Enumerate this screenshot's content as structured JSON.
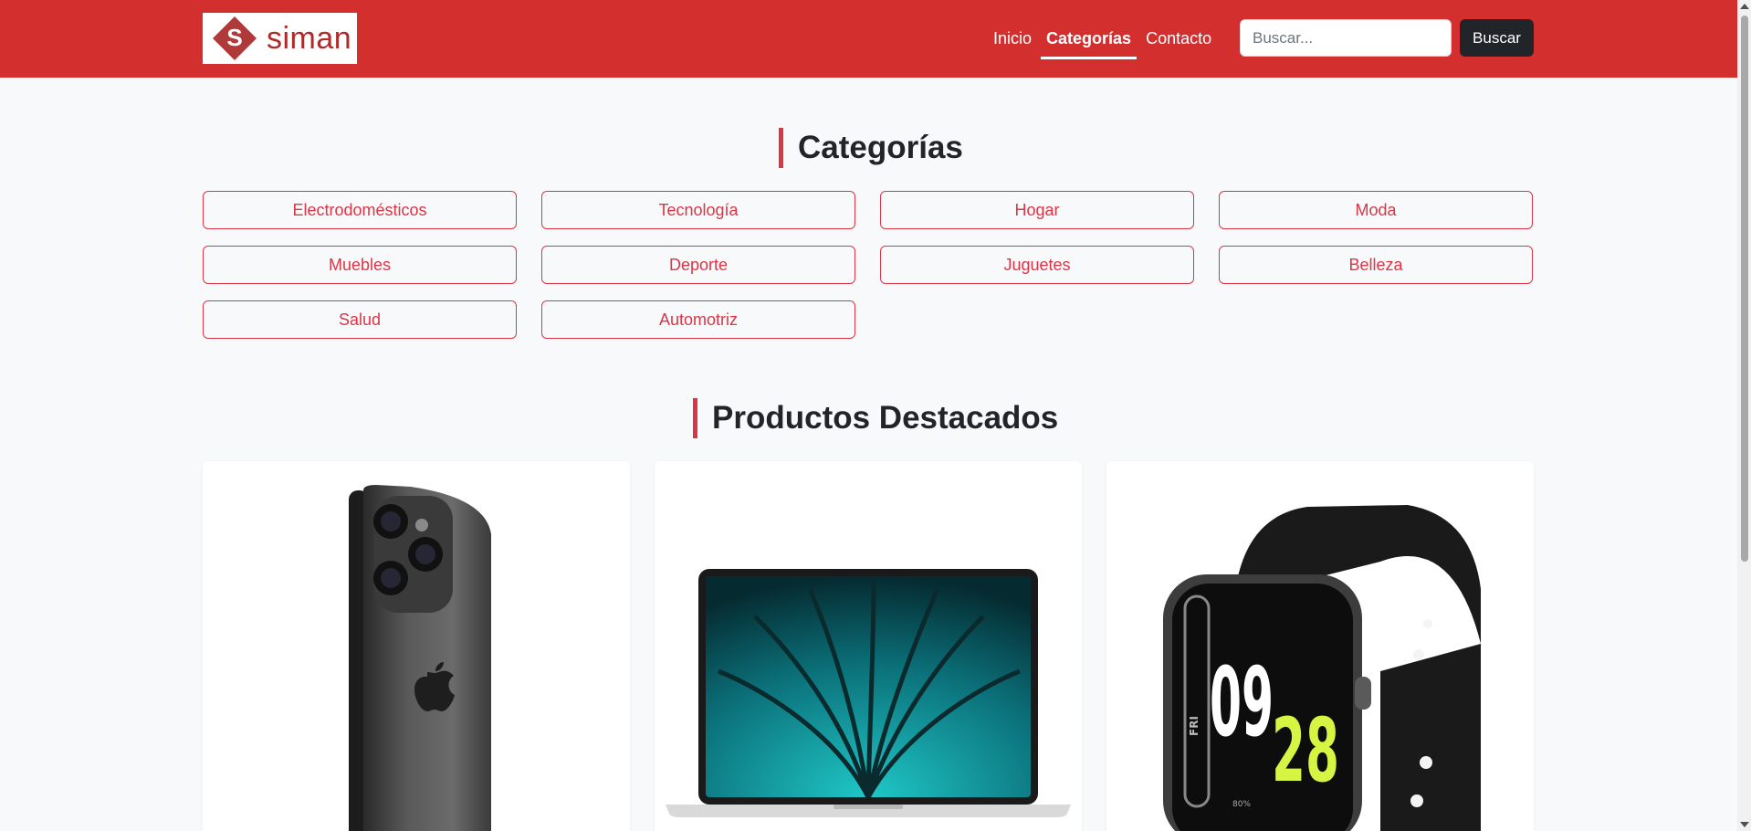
{
  "brand": {
    "name": "siman",
    "logo_letter": "S"
  },
  "nav": {
    "links": [
      {
        "label": "Inicio",
        "active": false
      },
      {
        "label": "Categorías",
        "active": true
      },
      {
        "label": "Contacto",
        "active": false
      }
    ]
  },
  "search": {
    "placeholder": "Buscar...",
    "value": "",
    "button_label": "Buscar"
  },
  "categories_section": {
    "title": "Categorías",
    "items": [
      "Electrodomésticos",
      "Tecnología",
      "Hogar",
      "Moda",
      "Muebles",
      "Deporte",
      "Juguetes",
      "Belleza",
      "Salud",
      "Automotriz"
    ]
  },
  "products_section": {
    "title": "Productos Destacados",
    "products": [
      {
        "image": "smartphone-image"
      },
      {
        "image": "laptop-image"
      },
      {
        "image": "smartwatch-image",
        "watch_face": {
          "hour": "09",
          "minute": "28",
          "day": "FRI",
          "battery": "80%"
        }
      }
    ]
  },
  "colors": {
    "navbar": "#d32f2f",
    "accent": "#dc3545",
    "dark": "#212529",
    "background": "#f8f9fa"
  }
}
